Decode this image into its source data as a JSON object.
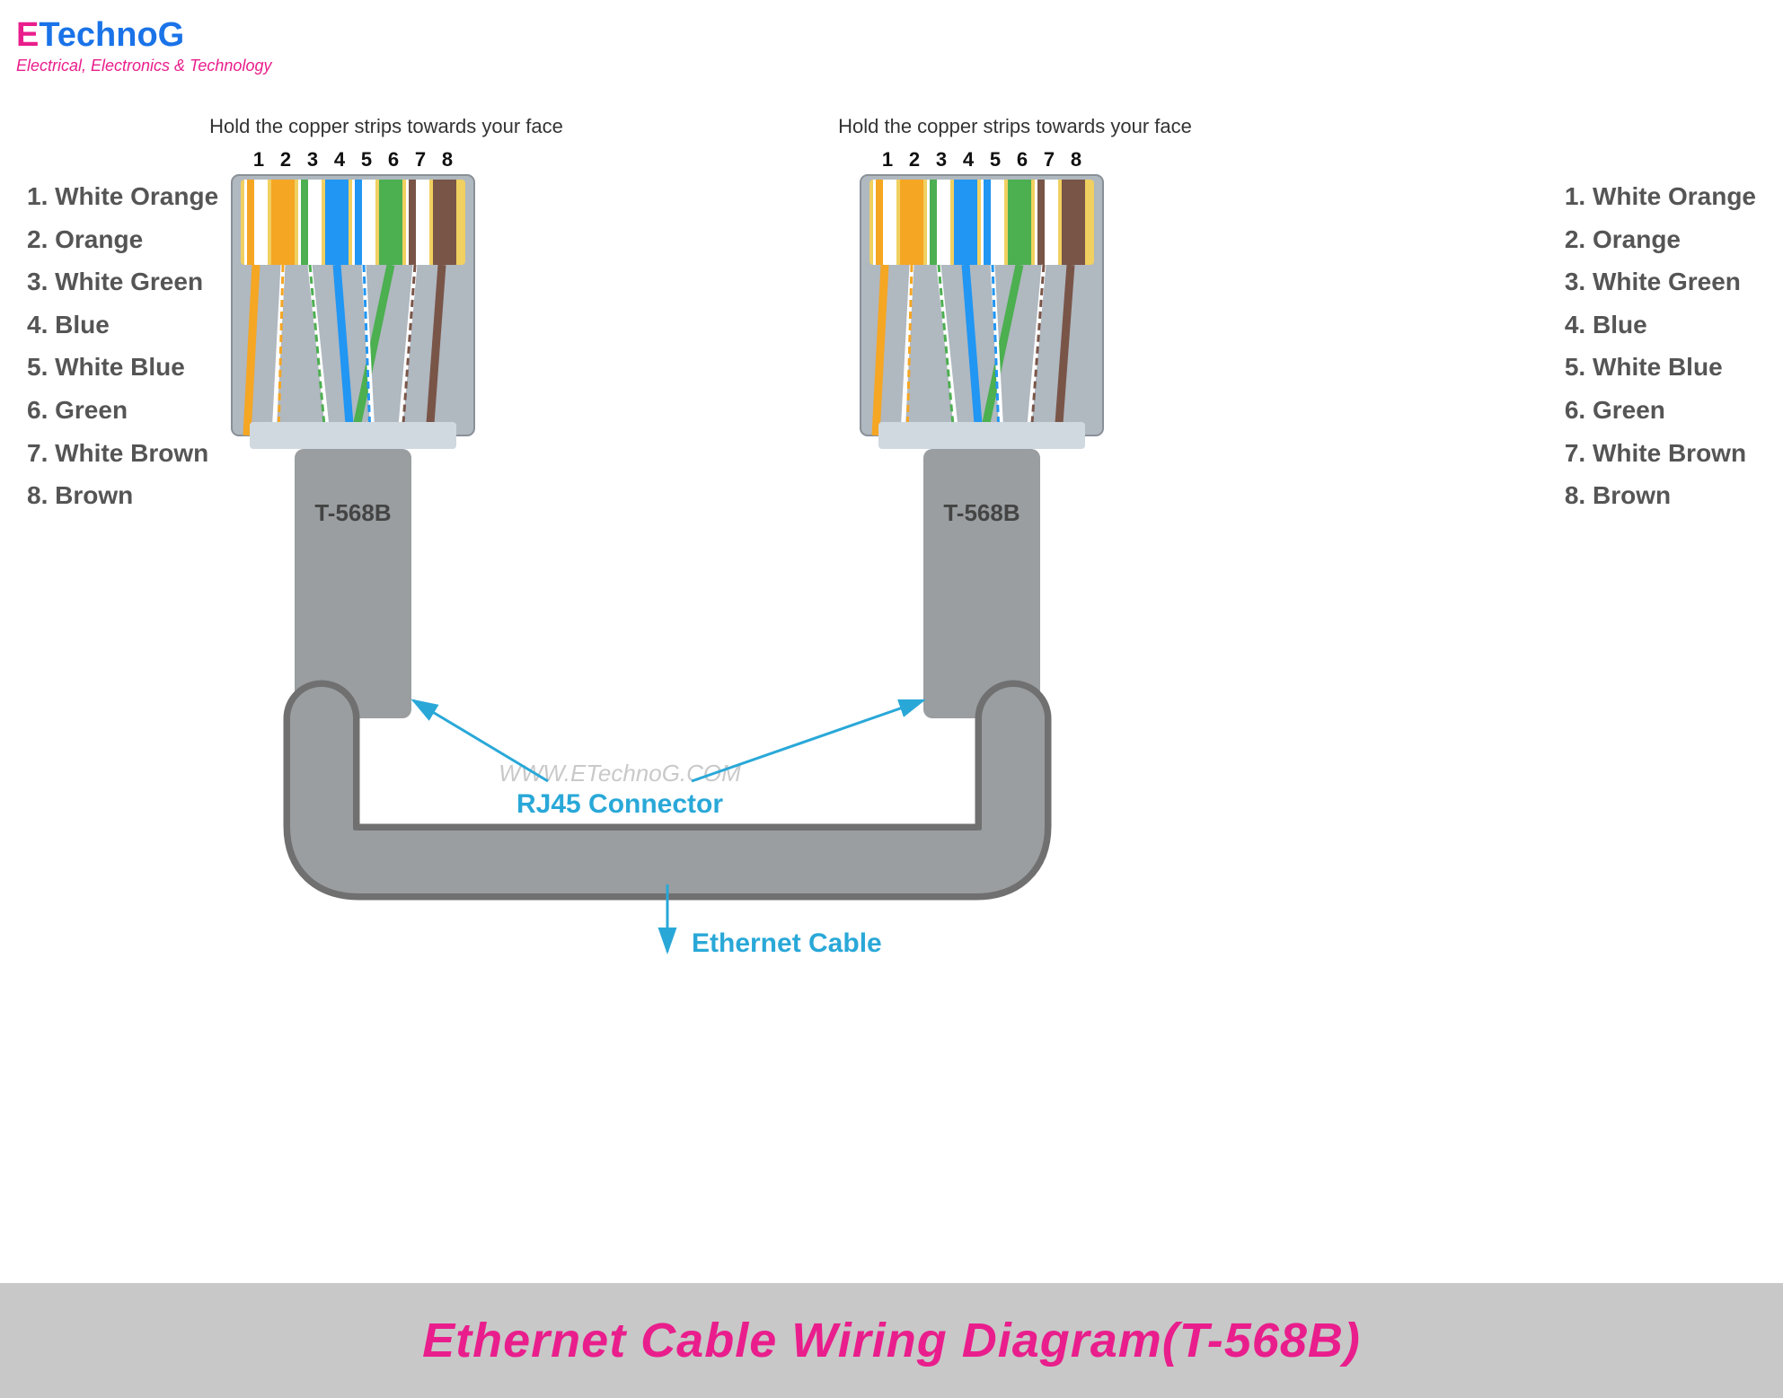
{
  "logo": {
    "e": "E",
    "technog": "TechnoG",
    "tagline": "Electrical, Electronics & Technology"
  },
  "instruction_left": "Hold the copper strips towards your face",
  "instruction_right": "Hold the copper strips towards your face",
  "pin_numbers": [
    "1",
    "2",
    "3",
    "4",
    "5",
    "6",
    "7",
    "8"
  ],
  "wire_list": [
    "1. White Orange",
    "2. Orange",
    "3. White Green",
    "4. Blue",
    "5. White Blue",
    "6. Green",
    "7. White Brown",
    "8. Brown"
  ],
  "connector_label_left": "T-568B",
  "connector_label_right": "T-568B",
  "rj45_label": "RJ45 Connector",
  "ethernet_label": "Ethernet Cable",
  "watermark": "WWW.ETechnoG.COM",
  "banner_text": "Ethernet Cable Wiring Diagram(T-568B)",
  "colors": {
    "pink": "#e91e8c",
    "blue": "#1a73e8",
    "cyan": "#29a8d8",
    "wire1": "#f5a623",
    "wire2": "#f5a623",
    "wire3": "#4caf50",
    "wire4": "#2196f3",
    "wire5": "#2196f3",
    "wire6": "#4caf50",
    "wire7": "#795548",
    "wire8": "#795548"
  }
}
